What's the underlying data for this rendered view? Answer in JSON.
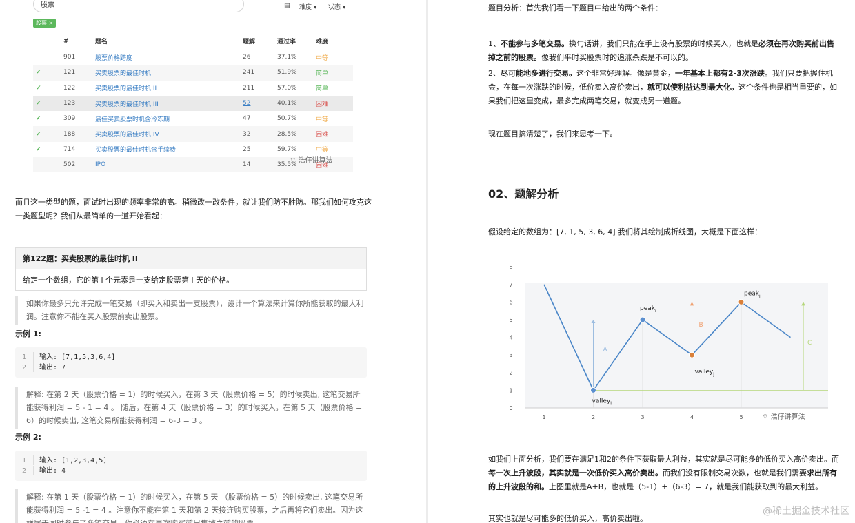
{
  "toolbar": {
    "search_value": "股票",
    "difficulty": "难度 ▾",
    "status": "状态 ▾",
    "tag": "股票 ×"
  },
  "table": {
    "headers": [
      "",
      "#",
      "题名",
      "题解",
      "通过率",
      "难度"
    ],
    "rows": [
      {
        "done": false,
        "id": "901",
        "title": "股票价格跨度",
        "solutions": "26",
        "rate": "37.1%",
        "level": "中等",
        "lvl": "medium"
      },
      {
        "done": true,
        "id": "121",
        "title": "买卖股票的最佳时机",
        "solutions": "241",
        "rate": "51.9%",
        "level": "简单",
        "lvl": "easy"
      },
      {
        "done": true,
        "id": "122",
        "title": "买卖股票的最佳时机 II",
        "solutions": "211",
        "rate": "57.0%",
        "level": "简单",
        "lvl": "easy"
      },
      {
        "done": true,
        "id": "123",
        "title": "买卖股票的最佳时机 III",
        "solutions": "52",
        "rate": "40.1%",
        "level": "困难",
        "lvl": "hard"
      },
      {
        "done": true,
        "id": "309",
        "title": "最佳买卖股票时机含冷冻期",
        "solutions": "47",
        "rate": "50.7%",
        "level": "中等",
        "lvl": "medium"
      },
      {
        "done": true,
        "id": "188",
        "title": "买卖股票的最佳时机 IV",
        "solutions": "32",
        "rate": "28.5%",
        "level": "困难",
        "lvl": "hard"
      },
      {
        "done": true,
        "id": "714",
        "title": "买卖股票的最佳时机含手续费",
        "solutions": "25",
        "rate": "59.7%",
        "level": "中等",
        "lvl": "medium"
      },
      {
        "done": false,
        "id": "502",
        "title": "IPO",
        "solutions": "14",
        "rate": "35.5%",
        "level": "困难",
        "lvl": "hard"
      }
    ]
  },
  "watermark": "浩仔讲算法",
  "left": {
    "intro": "而且这一类型的题，面试时出现的频率非常的高。稍微改一改条件，就让我们防不胜防。那我们如何攻克这一类题型呢？我们从最简单的一道开始看起：",
    "problem_title": "第122题：买卖股票的最佳时机 II",
    "problem_desc": "给定一个数组，它的第 i 个元素是一支给定股票第 i 天的价格。",
    "quote1": "如果你最多只允许完成一笔交易（即买入和卖出一支股票），设计一个算法来计算你所能获取的最大利润。注意你不能在买入股票前卖出股票。",
    "ex1_label": "示例 1:",
    "ex1_in": "输入: [7,1,5,3,6,4]",
    "ex1_out": "输出: 7",
    "ex1_explain": "解释:  在第 2 天（股票价格 = 1）的时候买入，在第 3 天（股票价格 = 5）的时候卖出, 这笔交易所能获得利润 = 5 - 1 = 4 。 随后，在第 4 天（股票价格 = 3）的时候买入，在第 5 天（股票价格 = 6）的时候卖出, 这笔交易所能获得利润 = 6-3 = 3 。",
    "ex2_label": "示例 2:",
    "ex2_in": "输入: [1,2,3,4,5]",
    "ex2_out": "输出: 4",
    "ex2_explain": "解释: 在第 1 天（股票价格 = 1）的时候买入，在第 5 天 （股票价格 = 5）的时候卖出, 这笔交易所能获得利润 = 5 -1 = 4 。注意你不能在第 1 天和第 2 天接连购买股票，之后再将它们卖出。因为这样属于同时参与了多笔交易，你必须在再次购买前出售掉之前的股票。"
  },
  "right": {
    "p1": "题目分析：首先我们看一下题目中给出的两个条件：",
    "p2_a": "1、",
    "p2_b": "不能参与多笔交易。",
    "p2_c": "换句话讲，我们只能在手上没有股票的时候买入，也就是",
    "p2_d": "必须在再次购买前出售掉之前的股票。",
    "p2_e": "像我们平时买股票时的追涨杀跌是不可以的。",
    "p3_a": "2、",
    "p3_b": "尽可能地多进行交易。",
    "p3_c": "这个非常好理解。像是黄金，",
    "p3_d": "一年基本上都有2-3次涨跌。",
    "p3_e": "我们只要把握住机会，在每一次涨跌的时候，低价卖入高价卖出，",
    "p3_f": "就可以使利益达到最大化。",
    "p3_g": "这个条件也是相当重要的，如果我们把这里变成，最多完成两笔交易，就变成另一道题。",
    "p4": "现在题目搞清楚了，我们来思考一下。",
    "h2": "02、题解分析",
    "p5": "假设给定的数组为：[7, 1, 5, 3, 6, 4]  我们将其绘制成折线图，大概是下面这样：",
    "p6_a": "如我们上面分析，我们要在满足1和2的条件下获取最大利益，其实就是尽可能多的低价买入高价卖出。而",
    "p6_b": "每一次上升波段，其实就是一次低价买入高价卖出。",
    "p6_c": "而我们没有限制交易次数，也就是我们需要",
    "p6_d": "求出所有的上升波段的和。",
    "p6_e": "上图里就是A+B，也就是（5-1）+（6-3）= 7，就是我们能获取到的最大利益。",
    "p7": "其实也就是尽可能多的低价买入，高价卖出啦。",
    "footer": "@稀土掘金技术社区"
  },
  "chart_data": {
    "type": "line",
    "x": [
      1,
      2,
      3,
      4,
      5,
      6
    ],
    "values": [
      7,
      1,
      5,
      3,
      6,
      4
    ],
    "x_ticks": [
      "1",
      "2",
      "3",
      "4",
      "5"
    ],
    "y_ticks": [
      "0",
      "1",
      "2",
      "3",
      "4",
      "5",
      "6",
      "7",
      "8"
    ],
    "ylim": [
      0,
      8
    ],
    "labels": {
      "valley_i": "valley",
      "peak_i": "peak",
      "valley_j": "valley",
      "peak_j": "peak",
      "A": "A",
      "B": "B",
      "C": "C",
      "sub_i": "i",
      "sub_j": "j"
    },
    "colors": {
      "line": "#4a86c8",
      "point": "#5b8fcf",
      "orange": "#d9803a",
      "A": "#9dbde0",
      "B": "#f0a070",
      "C": "#b5d67a"
    }
  }
}
